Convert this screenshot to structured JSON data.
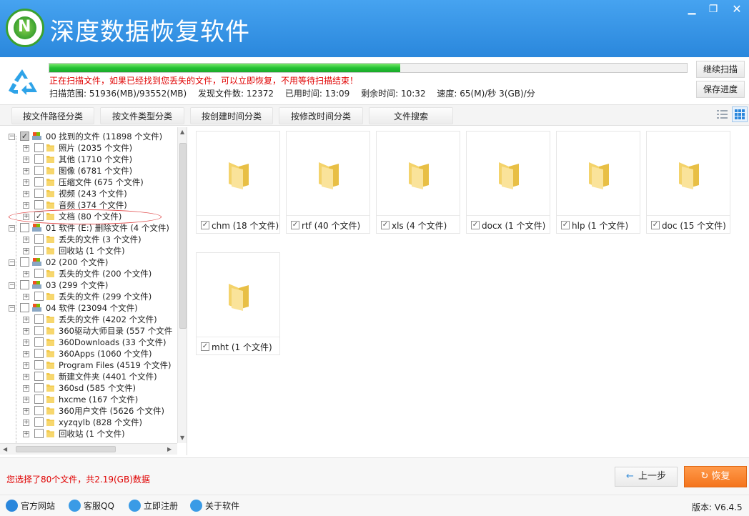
{
  "app": {
    "title": "深度数据恢复软件"
  },
  "window": {
    "minimize": "▁",
    "maximize": "❐",
    "close": "✕"
  },
  "scan": {
    "progress": 0.55,
    "message": "正在扫描文件，如果已经找到您丢失的文件，可以立即恢复，不用等待扫描结束！",
    "range": "扫描范围: 51936(MB)/93552(MB)",
    "found": "发现文件数: 12372",
    "elapsed": "已用时间: 13:09",
    "remaining": "剩余时间: 10:32",
    "speed": "速度: 65(M)/秒  3(GB)/分",
    "continue_label": "继续扫描",
    "save_label": "保存进度"
  },
  "tabs": [
    {
      "label": "按文件路径分类"
    },
    {
      "label": "按文件类型分类"
    },
    {
      "label": "按创建时间分类"
    },
    {
      "label": "按修改时间分类"
    },
    {
      "label": "文件搜索"
    }
  ],
  "tree": [
    {
      "level": 0,
      "label": "00 找到的文件  (11898 个文件)",
      "check": "partial",
      "icon": "drive"
    },
    {
      "level": 1,
      "label": "照片     (2035 个文件)",
      "check": "none",
      "icon": "folder"
    },
    {
      "level": 1,
      "label": "其他     (1710 个文件)",
      "check": "none",
      "icon": "folder"
    },
    {
      "level": 1,
      "label": "图像     (6781 个文件)",
      "check": "none",
      "icon": "folder"
    },
    {
      "level": 1,
      "label": "压缩文件    (675 个文件)",
      "check": "none",
      "icon": "folder"
    },
    {
      "level": 1,
      "label": "视频     (243 个文件)",
      "check": "none",
      "icon": "folder"
    },
    {
      "level": 1,
      "label": "音频     (374 个文件)",
      "check": "none",
      "icon": "folder"
    },
    {
      "level": 1,
      "label": "文档     (80 个文件)",
      "check": "checked",
      "icon": "folder"
    },
    {
      "level": 0,
      "label": "01 软件 (E:) 删除文件 (4 个文件)",
      "check": "none",
      "icon": "drive"
    },
    {
      "level": 1,
      "label": "丢失的文件     (3 个文件)",
      "check": "none",
      "icon": "folder"
    },
    {
      "level": 1,
      "label": "回收站      (1 个文件)",
      "check": "none",
      "icon": "folder"
    },
    {
      "level": 0,
      "label": "02  (200 个文件)",
      "check": "none",
      "icon": "drive"
    },
    {
      "level": 1,
      "label": "丢失的文件     (200 个文件)",
      "check": "none",
      "icon": "folder"
    },
    {
      "level": 0,
      "label": "03  (299 个文件)",
      "check": "none",
      "icon": "drive"
    },
    {
      "level": 1,
      "label": "丢失的文件     (299 个文件)",
      "check": "none",
      "icon": "folder"
    },
    {
      "level": 0,
      "label": "04 软件 (23094 个文件)",
      "check": "none",
      "icon": "drive"
    },
    {
      "level": 1,
      "label": "丢失的文件     (4202 个文件)",
      "check": "none",
      "icon": "folder"
    },
    {
      "level": 1,
      "label": "360驱动大师目录    (557 个文件",
      "check": "none",
      "icon": "folder"
    },
    {
      "level": 1,
      "label": "360Downloads     (33 个文件)",
      "check": "none",
      "icon": "folder"
    },
    {
      "level": 1,
      "label": "360Apps     (1060 个文件)",
      "check": "none",
      "icon": "folder"
    },
    {
      "level": 1,
      "label": "Program Files     (4519 个文件)",
      "check": "none",
      "icon": "folder"
    },
    {
      "level": 1,
      "label": "新建文件夹     (4401 个文件)",
      "check": "none",
      "icon": "folder"
    },
    {
      "level": 1,
      "label": "360sd     (585 个文件)",
      "check": "none",
      "icon": "folder"
    },
    {
      "level": 1,
      "label": "hxcme     (167 个文件)",
      "check": "none",
      "icon": "folder"
    },
    {
      "level": 1,
      "label": "360用户文件     (5626 个文件)",
      "check": "none",
      "icon": "folder"
    },
    {
      "level": 1,
      "label": "xyzqylb     (828 个文件)",
      "check": "none",
      "icon": "folder"
    },
    {
      "level": 1,
      "label": "回收站     (1 个文件)",
      "check": "none",
      "icon": "folder"
    }
  ],
  "files": [
    {
      "label": "chm (18 个文件)"
    },
    {
      "label": "rtf (40 个文件)"
    },
    {
      "label": "xls (4 个文件)"
    },
    {
      "label": "docx (1 个文件)"
    },
    {
      "label": "hlp (1 个文件)"
    },
    {
      "label": "doc (15 个文件)"
    },
    {
      "label": "mht (1 个文件)"
    }
  ],
  "status": {
    "selection": "您选择了80个文件，共2.19(GB)数据",
    "prev_label": "上一步",
    "recover_label": "恢复"
  },
  "footer": {
    "links": [
      {
        "label": "官方网站",
        "icon": "globe-icon"
      },
      {
        "label": "客服QQ",
        "icon": "qq-icon"
      },
      {
        "label": "立即注册",
        "icon": "register-icon"
      },
      {
        "label": "关于软件",
        "icon": "about-icon"
      }
    ],
    "version": "版本: V6.4.5"
  },
  "colors": {
    "accent": "#2a87dc",
    "recover": "#f4741d",
    "warning": "#e00000",
    "progress": "#23c233"
  }
}
